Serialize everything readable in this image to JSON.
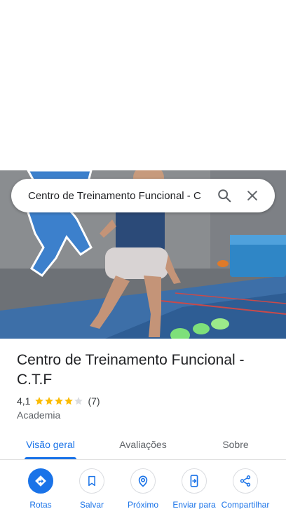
{
  "search": {
    "query": "Centro de Treinamento Funcional - C",
    "search_icon": "search-icon",
    "close_icon": "close-icon"
  },
  "place": {
    "title": "Centro de Treinamento Funcional - C.T.F",
    "rating": "4,1",
    "rating_value": 4.1,
    "review_count": "(7)",
    "category": "Academia"
  },
  "tabs": [
    {
      "label": "Visão geral",
      "active": true
    },
    {
      "label": "Avaliações",
      "active": false
    },
    {
      "label": "Sobre",
      "active": false
    }
  ],
  "actions": [
    {
      "label": "Rotas",
      "icon": "directions-icon"
    },
    {
      "label": "Salvar",
      "icon": "bookmark-icon"
    },
    {
      "label": "Próximo",
      "icon": "nearby-icon"
    },
    {
      "label": "Enviar para",
      "icon": "send-to-phone-icon"
    },
    {
      "label": "Compartilhar",
      "icon": "share-icon"
    }
  ],
  "colors": {
    "accent": "#1a73e8",
    "star": "#fbbc04",
    "star_empty": "#dadce0"
  }
}
